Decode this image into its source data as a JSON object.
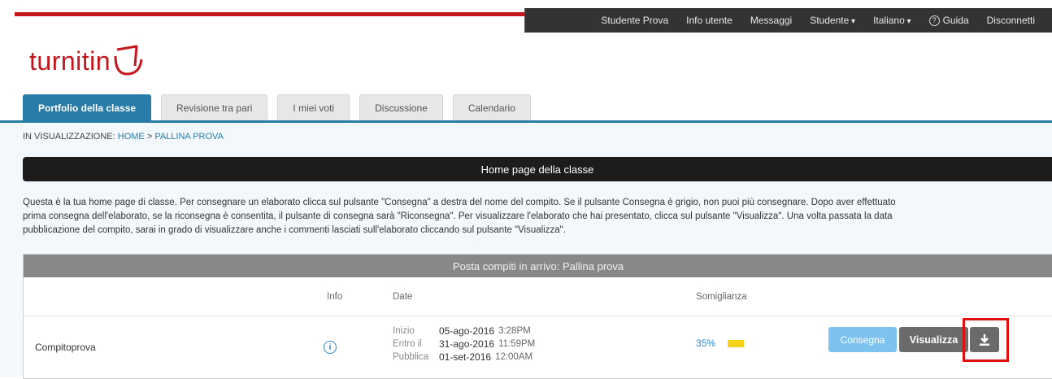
{
  "topnav": {
    "items": [
      {
        "label": "Studente Prova"
      },
      {
        "label": "Info utente"
      },
      {
        "label": "Messaggi"
      },
      {
        "label": "Studente"
      },
      {
        "label": "Italiano"
      },
      {
        "label": "Guida"
      },
      {
        "label": "Disconnetti"
      }
    ],
    "help_glyph": "?"
  },
  "logo": {
    "text": "turnitin"
  },
  "tabs": [
    {
      "label": "Portfolio della classe"
    },
    {
      "label": "Revisione tra pari"
    },
    {
      "label": "I miei voti"
    },
    {
      "label": "Discussione"
    },
    {
      "label": "Calendario"
    }
  ],
  "breadcrumb": {
    "prefix": "IN VISUALIZZAZIONE:",
    "home": "HOME",
    "separator": ">",
    "current": "PALLINA PROVA"
  },
  "page_title": "Home page della classe",
  "intro": {
    "line1": "Questa è la tua home page di classe. Per consegnare un elaborato clicca sul pulsante \"Consegna\" a destra del nome del compito. Se il pulsante Consegna è grigio, non puoi più consegnare. Dopo aver effettuato",
    "line2": "prima consegna dell'elaborato, se la riconsegna è consentita, il pulsante di consegna sarà \"Riconsegna\". Per visualizzare l'elaborato che hai presentato, clicca sul pulsante \"Visualizza\". Una volta passata la data",
    "line3": "pubblicazione del compito, sarai in grado di visualizzare anche i commenti lasciati sull'elaborato cliccando sul pulsante \"Visualizza\"."
  },
  "inbox": {
    "title": "Posta compiti in arrivo: Pallina prova",
    "columns": {
      "info": "Info",
      "date": "Date",
      "similarity": "Somiglianza"
    },
    "rows": [
      {
        "name": "Compitoprova",
        "info_glyph": "i",
        "start_label": "Inizio",
        "start_date": "05-ago-2016",
        "start_time": "3:28PM",
        "due_label": "Entro il",
        "due_date": "31-ago-2016",
        "due_time": "11:59PM",
        "post_label": "Pubblica",
        "post_date": "01-set-2016",
        "post_time": "12:00AM",
        "similarity": "35%",
        "similarity_color": "#f7d21b",
        "submit_label": "Consegna",
        "view_label": "Visualizza",
        "download_icon": "download-icon"
      }
    ]
  },
  "colors": {
    "brand": "#c4171d",
    "accent": "#2a7ca8",
    "highlight": "#e01010"
  }
}
